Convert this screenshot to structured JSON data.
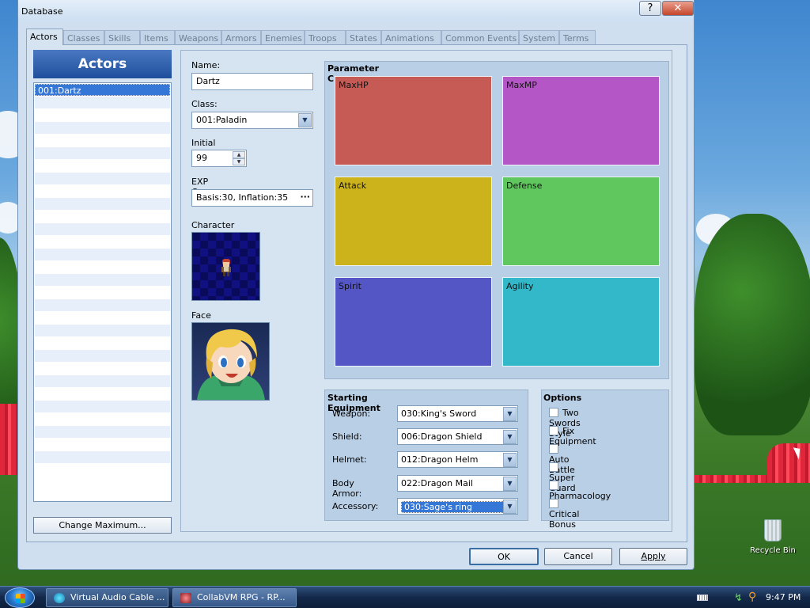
{
  "window": {
    "title": "Database",
    "help_glyph": "?",
    "close_glyph": "✕"
  },
  "tabs": [
    "Actors",
    "Classes",
    "Skills",
    "Items",
    "Weapons",
    "Armors",
    "Enemies",
    "Troops",
    "States",
    "Animations",
    "Common Events",
    "System",
    "Terms"
  ],
  "active_tab": "Actors",
  "actors_panel": {
    "header": "Actors",
    "items": [
      "001:Dartz"
    ],
    "selected_index": 0,
    "change_maximum_label": "Change Maximum..."
  },
  "general": {
    "name_label": "Name:",
    "name_value": "Dartz",
    "class_label": "Class:",
    "class_value": "001:Paladin",
    "initial_level_label": "Initial Level:",
    "initial_level_value": "99",
    "exp_curve_label": "EXP Curve:",
    "exp_curve_value": "Basis:30, Inflation:35",
    "exp_curve_button": "···",
    "character_graphic_label": "Character Graphic:",
    "face_graphic_label": "Face Graphic:"
  },
  "parameter_curves": {
    "title": "Parameter Curves",
    "curves": [
      {
        "label": "MaxHP",
        "color": "#c65a55"
      },
      {
        "label": "MaxMP",
        "color": "#b556c7"
      },
      {
        "label": "Attack",
        "color": "#cdb31b"
      },
      {
        "label": "Defense",
        "color": "#5fc75d"
      },
      {
        "label": "Spirit",
        "color": "#5456c5"
      },
      {
        "label": "Agility",
        "color": "#33b8c9"
      }
    ]
  },
  "starting_equipment": {
    "title": "Starting Equipment",
    "slots": [
      {
        "label": "Weapon:",
        "value": "030:King's Sword"
      },
      {
        "label": "Shield:",
        "value": "006:Dragon Shield"
      },
      {
        "label": "Helmet:",
        "value": "012:Dragon Helm"
      },
      {
        "label": "Body Armor:",
        "value": "022:Dragon Mail"
      },
      {
        "label": "Accessory:",
        "value": "030:Sage's ring"
      }
    ]
  },
  "options": {
    "title": "Options",
    "items": [
      {
        "label": "Two Swords Style",
        "checked": false
      },
      {
        "label": "Fix Equipment",
        "checked": false
      },
      {
        "label": "Auto Battle",
        "checked": false
      },
      {
        "label": "Super Guard",
        "checked": false
      },
      {
        "label": "Pharmacology",
        "checked": false
      },
      {
        "label": "Critical Bonus",
        "checked": false
      }
    ]
  },
  "buttons": {
    "ok": "OK",
    "cancel": "Cancel",
    "apply": "Apply"
  },
  "desktop": {
    "recycle_bin_label": "Recycle Bin"
  },
  "taskbar": {
    "tasks": [
      "Virtual Audio Cable ...",
      "CollabVM RPG - RP..."
    ],
    "clock": "9:47 PM"
  }
}
